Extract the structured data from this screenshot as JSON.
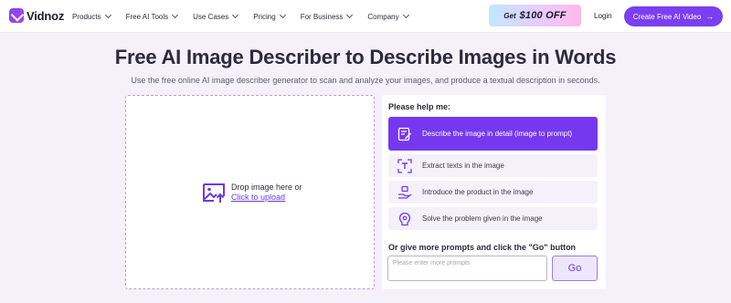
{
  "brand": {
    "name": "Vidnoz"
  },
  "nav": {
    "items": [
      {
        "label": "Products"
      },
      {
        "label": "Free AI Tools"
      },
      {
        "label": "Use Cases"
      },
      {
        "label": "Pricing"
      },
      {
        "label": "For Business"
      },
      {
        "label": "Company"
      }
    ],
    "promo_get": "Get",
    "promo_amount": "$100 OFF",
    "login_label": "Login",
    "cta_label": "Create Free AI Video",
    "cta_arrow": "→"
  },
  "hero": {
    "title": "Free AI Image Describer to Describe Images in Words",
    "subtitle": "Use the free online AI image describer generator to scan and analyze your images, and produce a textual description in seconds."
  },
  "upload": {
    "line1": "Drop image here or",
    "link": "Click to upload"
  },
  "panel": {
    "label": "Please help me:",
    "options": [
      {
        "label": "Describe the image in detail (image to prompt)",
        "icon": "edit-note-icon",
        "active": true
      },
      {
        "label": "Extract texts in the image",
        "icon": "text-scan-icon",
        "active": false
      },
      {
        "label": "Introduce the product in the image",
        "icon": "product-hand-icon",
        "active": false
      },
      {
        "label": "Solve the problem given in the image",
        "icon": "lightbulb-brain-icon",
        "active": false
      }
    ],
    "prompt_label": "Or give more prompts and click the \"Go\" button",
    "prompt_placeholder": "Please enter more prompts",
    "prompt_value": "",
    "go_label": "Go"
  },
  "colors": {
    "accent": "#7638ee",
    "page_bg": "#f4f1fb",
    "link": "#6a3be8"
  }
}
